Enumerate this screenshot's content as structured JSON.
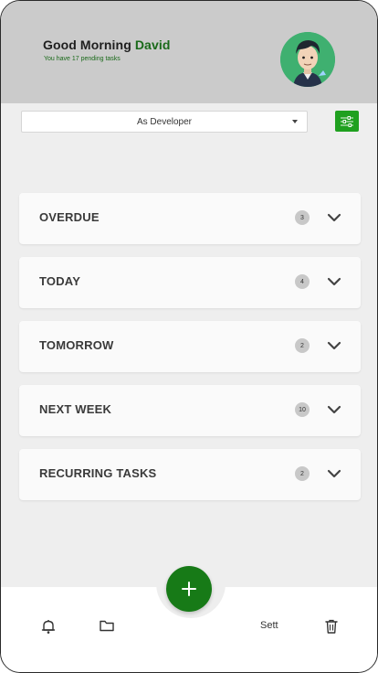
{
  "header": {
    "greeting": "Good Morning",
    "user_name": "David",
    "subtitle": "You have 17 pending tasks"
  },
  "role_select": {
    "selected": "As Developer"
  },
  "sections": [
    {
      "label": "OVERDUE",
      "count": "3"
    },
    {
      "label": "TODAY",
      "count": "4"
    },
    {
      "label": "TOMORROW",
      "count": "2"
    },
    {
      "label": "NEXT WEEK",
      "count": "10"
    },
    {
      "label": "RECURRING TASKS",
      "count": "2"
    }
  ],
  "bottom_nav": {
    "settings_label": "Sett",
    "icons": [
      "bell-icon",
      "folder-icon",
      "plus-icon",
      "trash-icon"
    ]
  },
  "colors": {
    "accent_green": "#1a6a1a",
    "fab_green": "#177a17",
    "filter_green": "#1fa01f",
    "header_bg": "#cbcbcb"
  }
}
